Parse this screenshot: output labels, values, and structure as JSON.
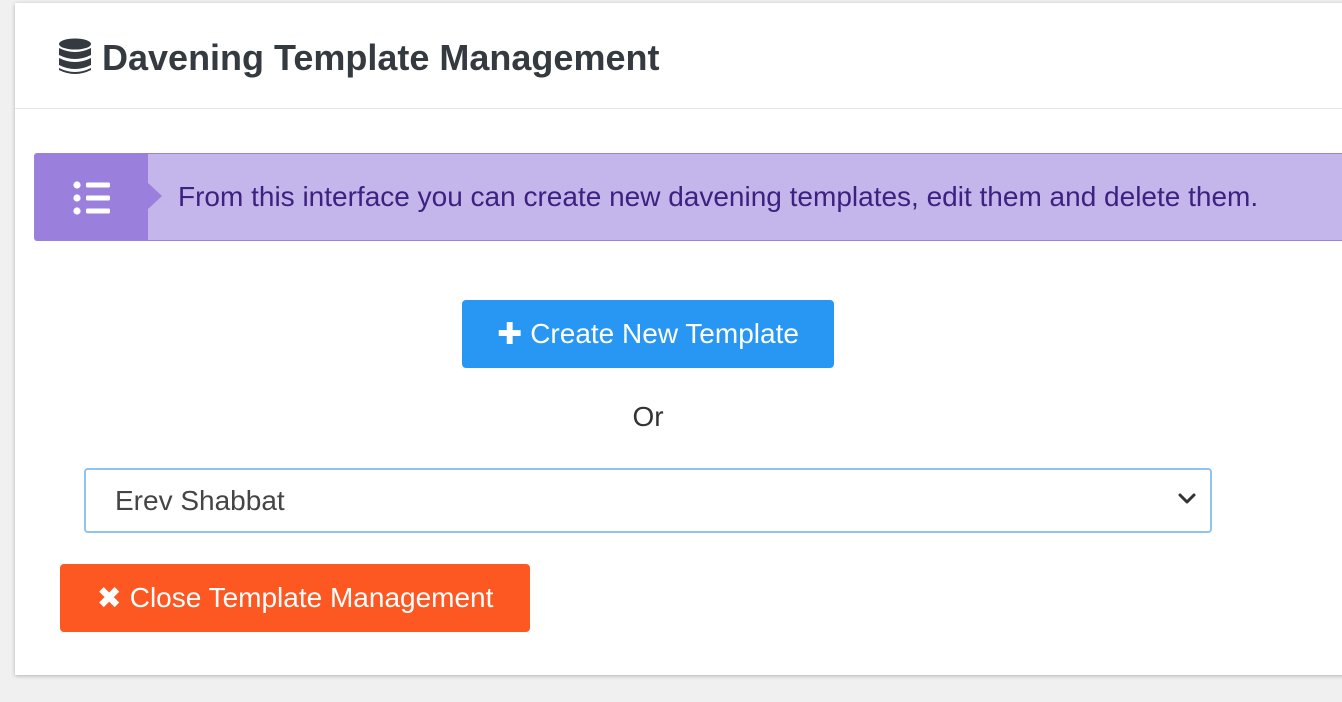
{
  "header": {
    "icon": "database-icon",
    "title": "Davening Template Management"
  },
  "callout": {
    "icon": "list-icon",
    "text": "From this interface you can create new davening templates, edit them and delete them.",
    "colors": {
      "background": "#c4b5eb",
      "icon_box": "#9b7fdc",
      "text": "#3c2280"
    }
  },
  "create_button": {
    "icon": "plus-icon",
    "icon_glyph": "✚",
    "label": "Create New Template",
    "color": "#2896f3"
  },
  "separator": {
    "text": "Or"
  },
  "template_select": {
    "selected": "Erev Shabbat",
    "icon": "chevron-down-icon"
  },
  "close_button": {
    "icon": "close-icon",
    "icon_glyph": "✖",
    "label": "Close Template Management",
    "color": "#fd5722"
  }
}
